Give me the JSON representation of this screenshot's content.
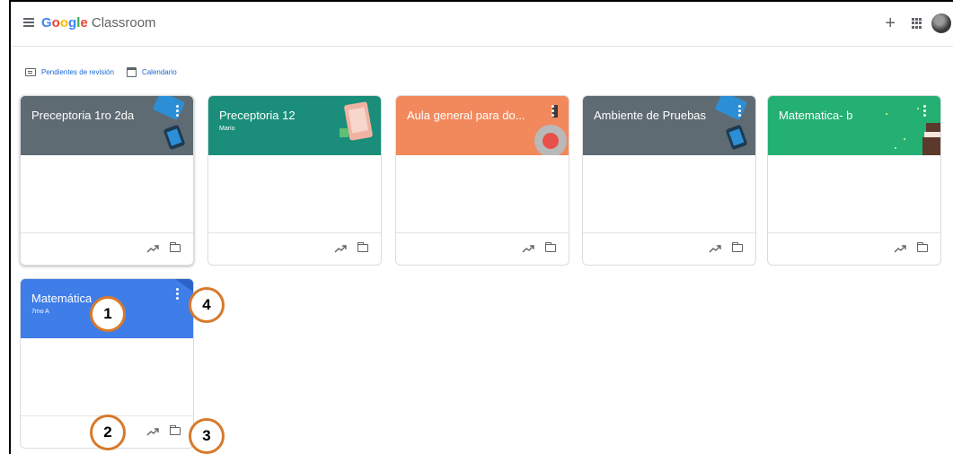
{
  "header": {
    "logo_google": "Google",
    "logo_product": "Classroom",
    "plus_glyph": "+"
  },
  "subnav": {
    "todo_label": "Pendientes de revisión",
    "calendar_label": "Calendario"
  },
  "classes": [
    {
      "title": "Preceptoria 1ro 2da",
      "subtitle": "",
      "color": "#5f6b73"
    },
    {
      "title": "Preceptoria 12",
      "subtitle": "Mario",
      "color": "#1a8e7a"
    },
    {
      "title": "Aula general para do...",
      "subtitle": "",
      "color": "#f2895c"
    },
    {
      "title": "Ambiente de Pruebas",
      "subtitle": "",
      "color": "#5f6b73"
    },
    {
      "title": "Matematica- b",
      "subtitle": "",
      "color": "#23b072"
    },
    {
      "title": "Matemática",
      "subtitle": "7mo A",
      "color": "#3f7de8"
    }
  ],
  "markers": [
    "1",
    "2",
    "3",
    "4"
  ],
  "icons": {
    "menu": "menu-icon",
    "plus": "plus-icon",
    "apps": "apps-icon",
    "todo": "todo-icon",
    "calendar": "calendar-icon",
    "more": "more-vert-icon",
    "trend": "trending-up-icon",
    "folder": "folder-icon"
  }
}
